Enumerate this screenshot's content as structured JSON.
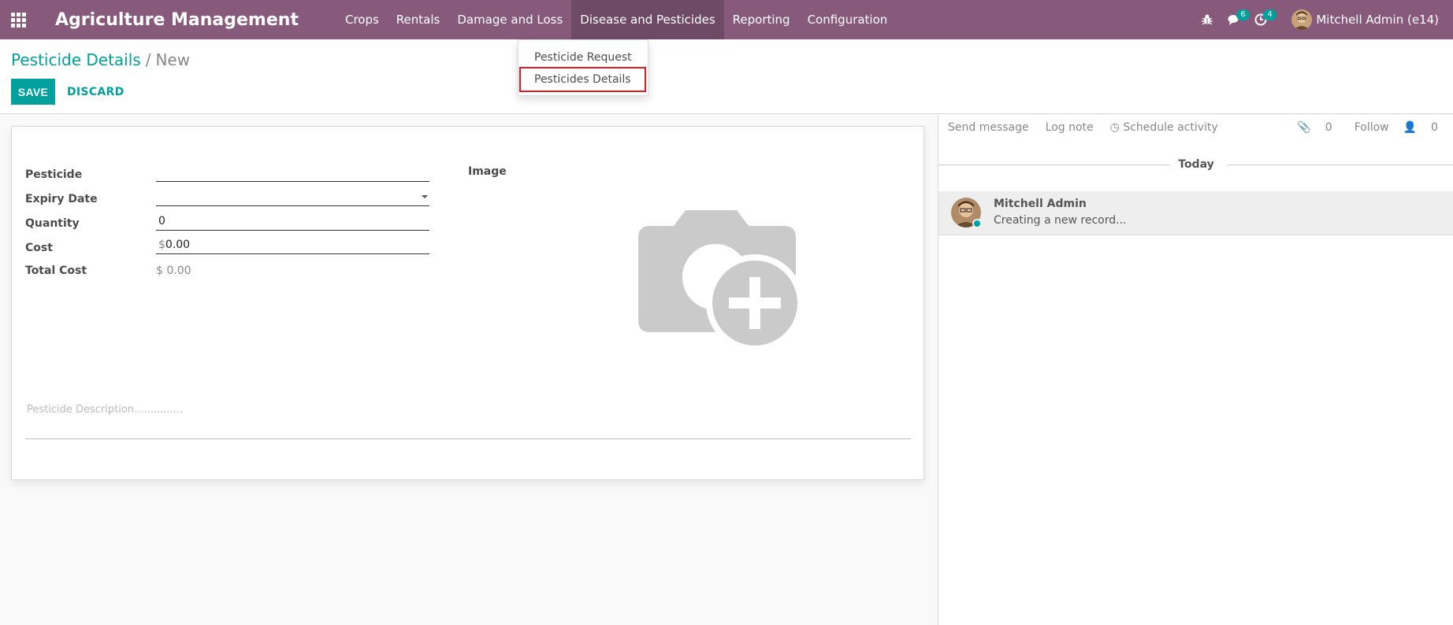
{
  "navbar": {
    "brand": "Agriculture Management",
    "menu": [
      "Crops",
      "Rentals",
      "Damage and Loss",
      "Disease and Pesticides",
      "Reporting",
      "Configuration"
    ],
    "active_menu": "Disease and Pesticides",
    "messages_count": "6",
    "activities_count": "4",
    "user_name": "Mitchell Admin (e14)",
    "color": "#875a7b"
  },
  "dropdown": {
    "items": [
      "Pesticide Request",
      "Pesticides Details"
    ],
    "highlighted": "Pesticides Details"
  },
  "breadcrumb": {
    "parent": "Pesticide Details",
    "separator": "/",
    "current": "New"
  },
  "buttons": {
    "save": "SAVE",
    "discard": "DISCARD"
  },
  "form": {
    "pesticide_label": "Pesticide",
    "pesticide_value": "",
    "expiry_label": "Expiry Date",
    "expiry_value": "",
    "quantity_label": "Quantity",
    "quantity_value": "0",
    "cost_label": "Cost",
    "cost_currency": "$",
    "cost_value": "0.00",
    "total_label": "Total Cost",
    "total_value": "$ 0.00",
    "image_label": "Image",
    "description_placeholder": "Pesticide Description..............."
  },
  "chatter": {
    "send_message": "Send message",
    "log_note": "Log note",
    "schedule_activity": "Schedule activity",
    "attachments": "0",
    "follow": "Follow",
    "followers": "0",
    "today": "Today",
    "author": "Mitchell Admin",
    "body": "Creating a new record..."
  },
  "colors": {
    "accent": "#00a09d",
    "highlight_box": "#e01b24"
  }
}
